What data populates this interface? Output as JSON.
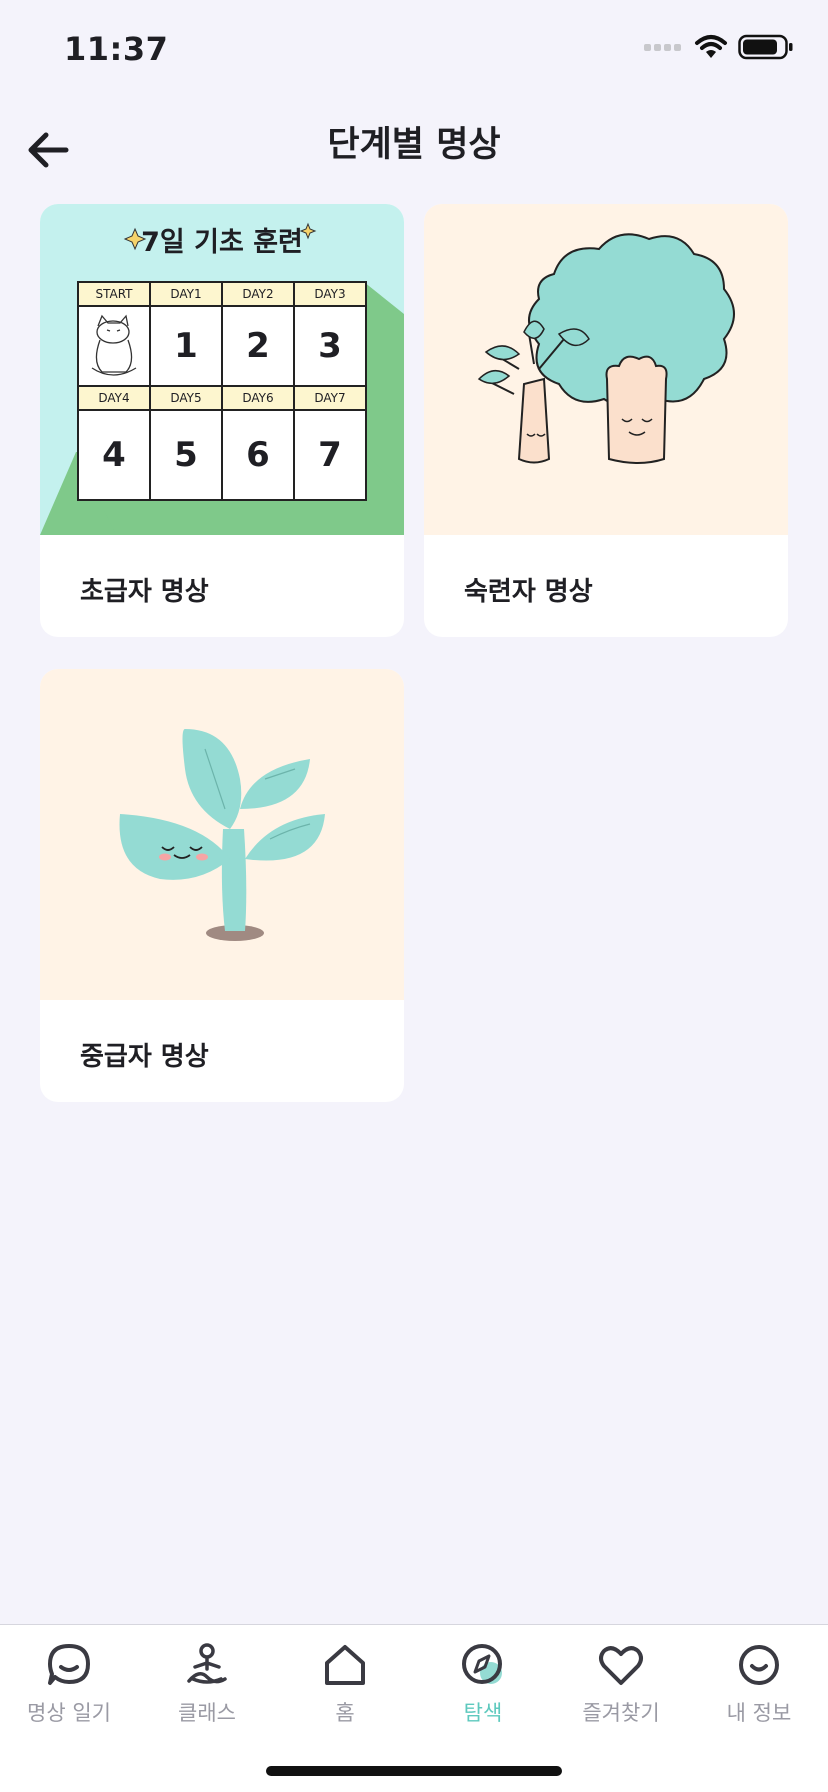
{
  "status_bar": {
    "time": "11:37"
  },
  "header": {
    "title": "단계별 명상"
  },
  "cards": [
    {
      "label": "초급자 명상",
      "banner_title": "7일 기초 훈련",
      "calendar": {
        "row1_headers": [
          "START",
          "DAY1",
          "DAY2",
          "DAY3"
        ],
        "row1_values": [
          "",
          "1",
          "2",
          "3"
        ],
        "row2_headers": [
          "DAY4",
          "DAY5",
          "DAY6",
          "DAY7"
        ],
        "row2_values": [
          "4",
          "5",
          "6",
          "7"
        ]
      }
    },
    {
      "label": "숙련자 명상"
    },
    {
      "label": "중급자 명상"
    }
  ],
  "tab_bar": {
    "items": [
      {
        "label": "명상 일기",
        "icon": "chat-smile-icon"
      },
      {
        "label": "클래스",
        "icon": "meditation-person-icon"
      },
      {
        "label": "홈",
        "icon": "home-icon"
      },
      {
        "label": "탐색",
        "icon": "compass-icon"
      },
      {
        "label": "즐겨찾기",
        "icon": "heart-icon"
      },
      {
        "label": "내 정보",
        "icon": "smile-face-icon"
      }
    ],
    "active_index": 3
  },
  "colors": {
    "background": "#f4f3fb",
    "accent": "#5ec9be",
    "mint_card": "#c4f1ee",
    "cream_card": "#fff3e6",
    "tree_teal": "#94dbd3"
  }
}
